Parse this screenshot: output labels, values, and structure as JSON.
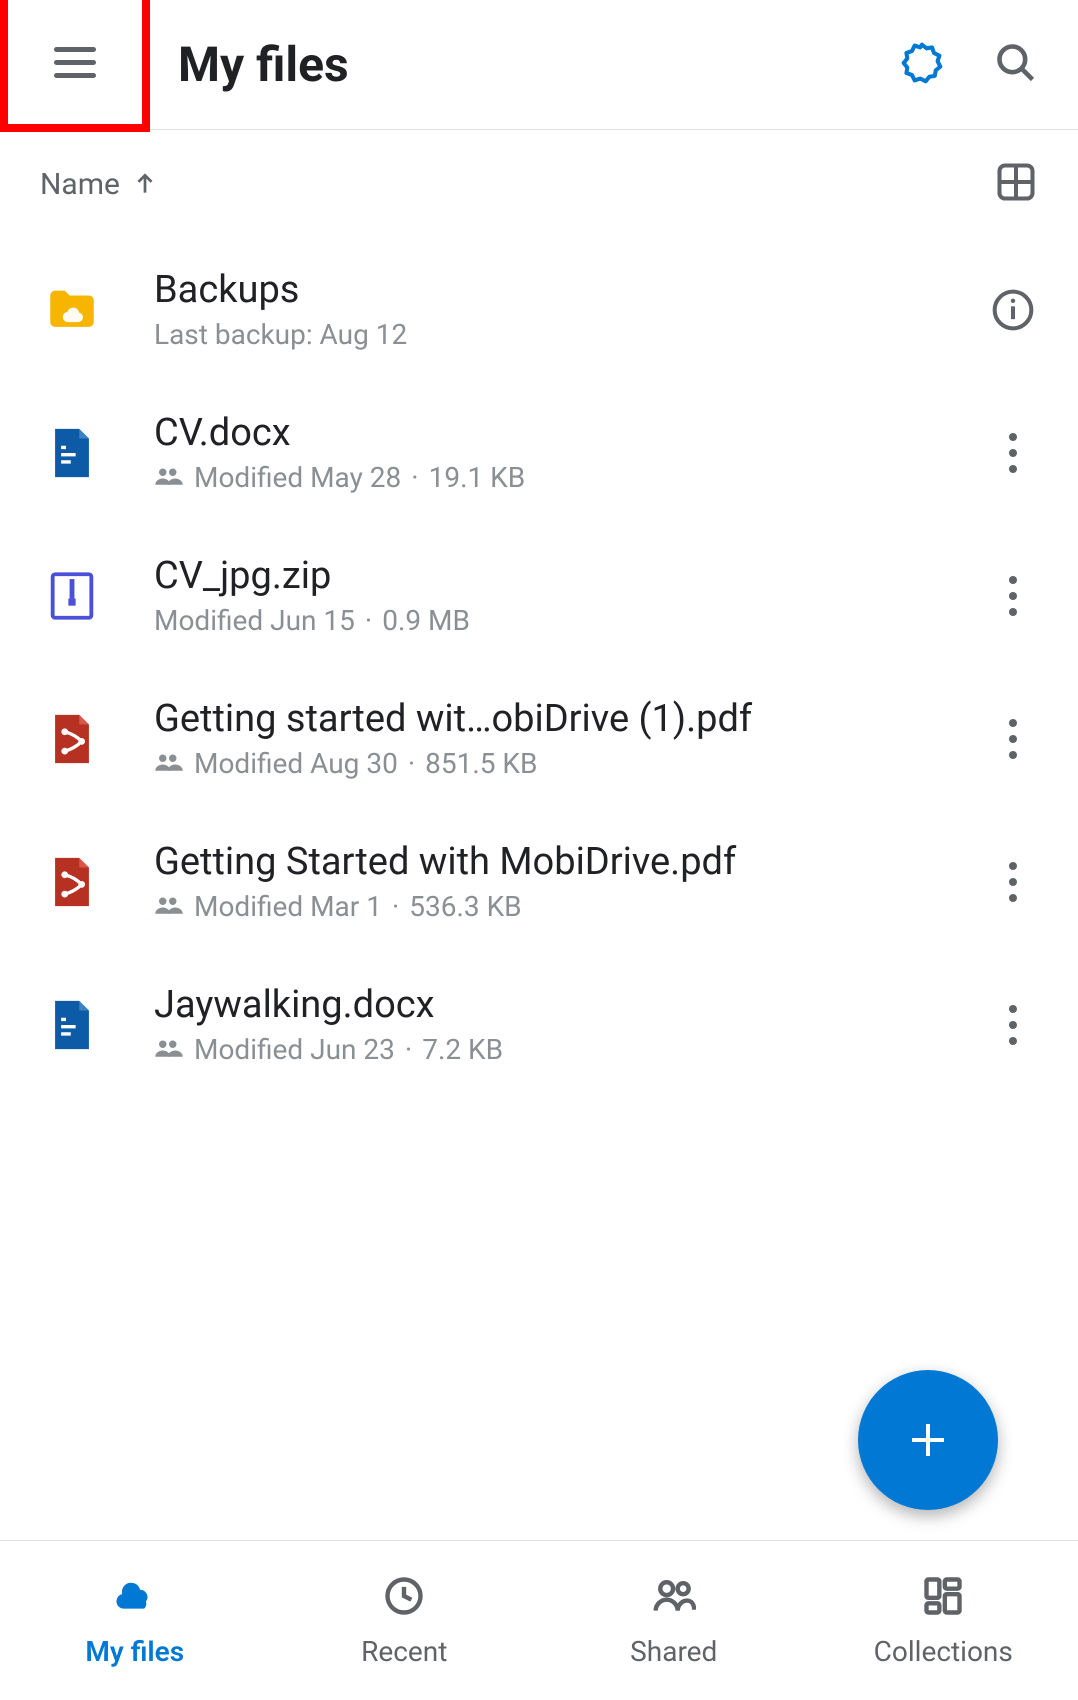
{
  "header": {
    "title": "My files"
  },
  "sort": {
    "label": "Name"
  },
  "files": [
    {
      "name": "Backups",
      "meta": "Last backup: Aug 12",
      "type": "folder-cloud",
      "shared": false,
      "action": "info",
      "size": null
    },
    {
      "name": "CV.docx",
      "meta": "Modified May 28",
      "type": "docx",
      "shared": true,
      "action": "more",
      "size": "19.1 KB"
    },
    {
      "name": "CV_jpg.zip",
      "meta": "Modified Jun 15",
      "type": "zip",
      "shared": false,
      "action": "more",
      "size": "0.9 MB"
    },
    {
      "name": "Getting started wit…obiDrive (1).pdf",
      "meta": "Modified Aug 30",
      "type": "pdf",
      "shared": true,
      "action": "more",
      "size": "851.5 KB"
    },
    {
      "name": "Getting Started with MobiDrive.pdf",
      "meta": "Modified Mar 1",
      "type": "pdf",
      "shared": true,
      "action": "more",
      "size": "536.3 KB"
    },
    {
      "name": "Jaywalking.docx",
      "meta": "Modified Jun 23",
      "type": "docx",
      "shared": true,
      "action": "more",
      "size": "7.2 KB"
    }
  ],
  "nav": {
    "items": [
      {
        "label": "My files",
        "icon": "cloud",
        "active": true
      },
      {
        "label": "Recent",
        "icon": "clock",
        "active": false
      },
      {
        "label": "Shared",
        "icon": "people",
        "active": false
      },
      {
        "label": "Collections",
        "icon": "collections",
        "active": false
      }
    ]
  }
}
